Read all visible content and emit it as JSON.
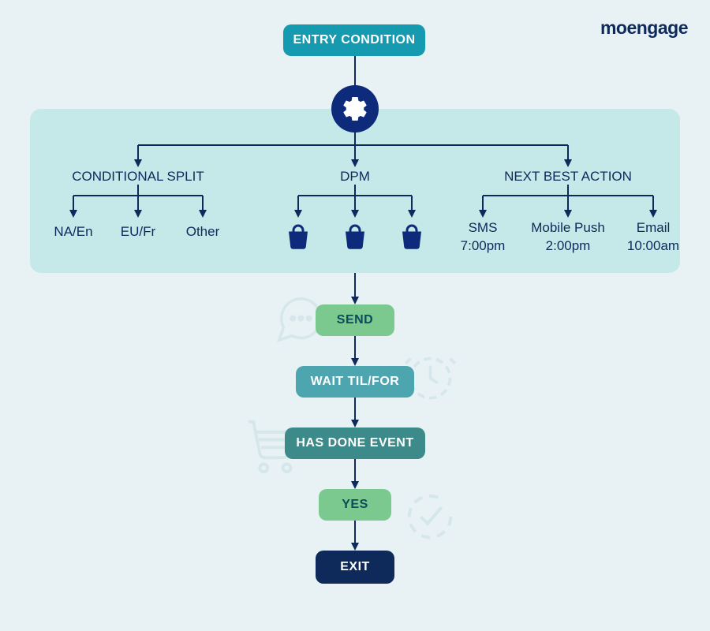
{
  "brand": {
    "logo": "moengage"
  },
  "flow": {
    "entry": "ENTRY CONDITION",
    "send": "SEND",
    "wait": "WAIT TIL/FOR",
    "event": "HAS DONE EVENT",
    "yes": "YES",
    "exit": "EXIT"
  },
  "panel": {
    "split": {
      "title": "CONDITIONAL SPLIT",
      "leaves": [
        "NA/En",
        "EU/Fr",
        "Other"
      ]
    },
    "dpm": {
      "title": "DPM"
    },
    "nba": {
      "title": "NEXT BEST ACTION",
      "leaves": [
        {
          "channel": "SMS",
          "time": "7:00pm"
        },
        {
          "channel": "Mobile Push",
          "time": "2:00pm"
        },
        {
          "channel": "Email",
          "time": "10:00am"
        }
      ]
    }
  },
  "colors": {
    "navy": "#0d2a5b",
    "deepblue": "#0d2a7b",
    "teal": "#159ab0",
    "tealmid": "#4da5b0",
    "tealdark": "#3d8a8a",
    "green": "#7bc98f",
    "panel": "#c5e8e8",
    "bg": "#e8f2f5"
  }
}
